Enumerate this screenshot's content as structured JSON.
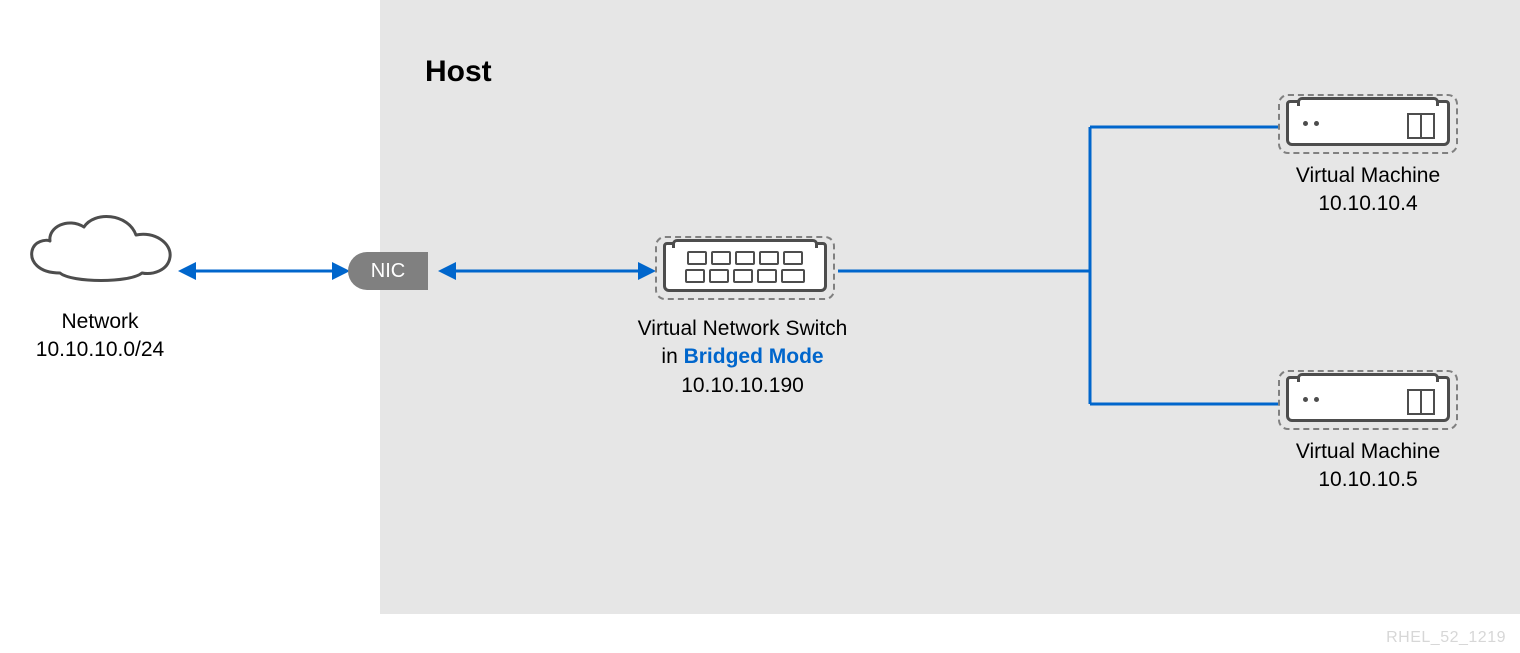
{
  "host": {
    "title": "Host"
  },
  "network": {
    "label": "Network",
    "cidr": "10.10.10.0/24"
  },
  "nic": {
    "label": "NIC"
  },
  "switch": {
    "line1": "Virtual Network Switch",
    "line2_prefix": "in ",
    "mode": "Bridged Mode",
    "ip": "10.10.10.190"
  },
  "vm1": {
    "label": "Virtual Machine",
    "ip": "10.10.10.4"
  },
  "vm2": {
    "label": "Virtual Machine",
    "ip": "10.10.10.5"
  },
  "watermark": "RHEL_52_1219",
  "colors": {
    "accent": "#06c",
    "host_bg": "#e6e6e6",
    "icon_stroke": "#4d4d4d"
  }
}
